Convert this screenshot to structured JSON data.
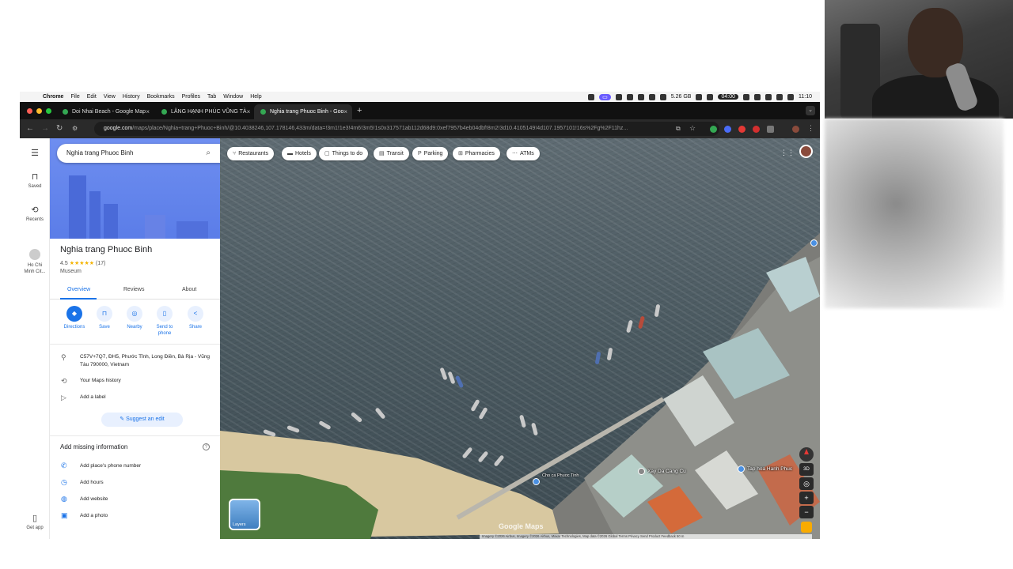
{
  "menubar": {
    "items": [
      "Chrome",
      "File",
      "Edit",
      "View",
      "History",
      "Bookmarks",
      "Profiles",
      "Tab",
      "Window",
      "Help"
    ],
    "storage": "5.26 GB",
    "timer": "04:00",
    "clock": "11:10"
  },
  "tabs": [
    {
      "title": "Doi Nhai Beach - Google Map",
      "active": false
    },
    {
      "title": "LĂNG HẠNH PHÚC VŨNG TÀ",
      "active": false
    },
    {
      "title": "Nghia trang Phuoc Binh - Goo",
      "active": true
    }
  ],
  "address": {
    "host": "google.com",
    "path": "/maps/place/Nghia+trang+Phuoc+Binh/@10.4038246,107.178146,433m/data=!3m1!1e3!4m6!3m5!1s0x317571ab112d68d9:0xef7957b4eb04dbf!8m2!3d10.4105149!4d107.1957101!16s%2Fg%2F11hz..."
  },
  "rail": {
    "saved": "Saved",
    "recents": "Recents",
    "hcm": "Ho Chi Minh Cit...",
    "getapp": "Get app"
  },
  "search": {
    "value": "Nghia trang Phuoc Binh"
  },
  "place": {
    "name": "Nghia trang Phuoc Binh",
    "rating": "4.5",
    "stars": "★★★★★",
    "reviews_count": "(17)",
    "type": "Museum",
    "tabs": [
      "Overview",
      "Reviews",
      "About"
    ],
    "actions": [
      {
        "label": "Directions",
        "icon": "directions-icon"
      },
      {
        "label": "Save",
        "icon": "bookmark-icon"
      },
      {
        "label": "Nearby",
        "icon": "nearby-icon"
      },
      {
        "label": "Send to phone",
        "icon": "phone-icon"
      },
      {
        "label": "Share",
        "icon": "share-icon"
      }
    ],
    "address": "C57V+7Q7, ĐH5, Phước Tỉnh, Long Điền, Bà Rịa - Vũng Tàu 790000, Vietnam",
    "maps_history": "Your Maps history",
    "add_label": "Add a label",
    "suggest_edit": "Suggest an edit",
    "missing_title": "Add missing information",
    "missing_items": [
      "Add place's phone number",
      "Add hours",
      "Add website",
      "Add a photo"
    ]
  },
  "map": {
    "chips": [
      "Restaurants",
      "Hotels",
      "Things to do",
      "Transit",
      "Parking",
      "Pharmacies",
      "ATMs"
    ],
    "layers_label": "Layers",
    "logo": "Google Maps",
    "labels": [
      "Xay Da Cang Cu",
      "Tap hoa Hanh Phuc",
      "Cho ca Phuoc Tinh"
    ],
    "attribution": "Imagery ©2026 Airbus, Imagery ©2026 Airbus, Maxar Technologies, Map data ©2026   Global   Terms   Privacy   Send Product Feedback   50 m"
  },
  "colors": {
    "accent": "#1a73e8",
    "hero": "#5b7de8",
    "star": "#f4b400"
  }
}
